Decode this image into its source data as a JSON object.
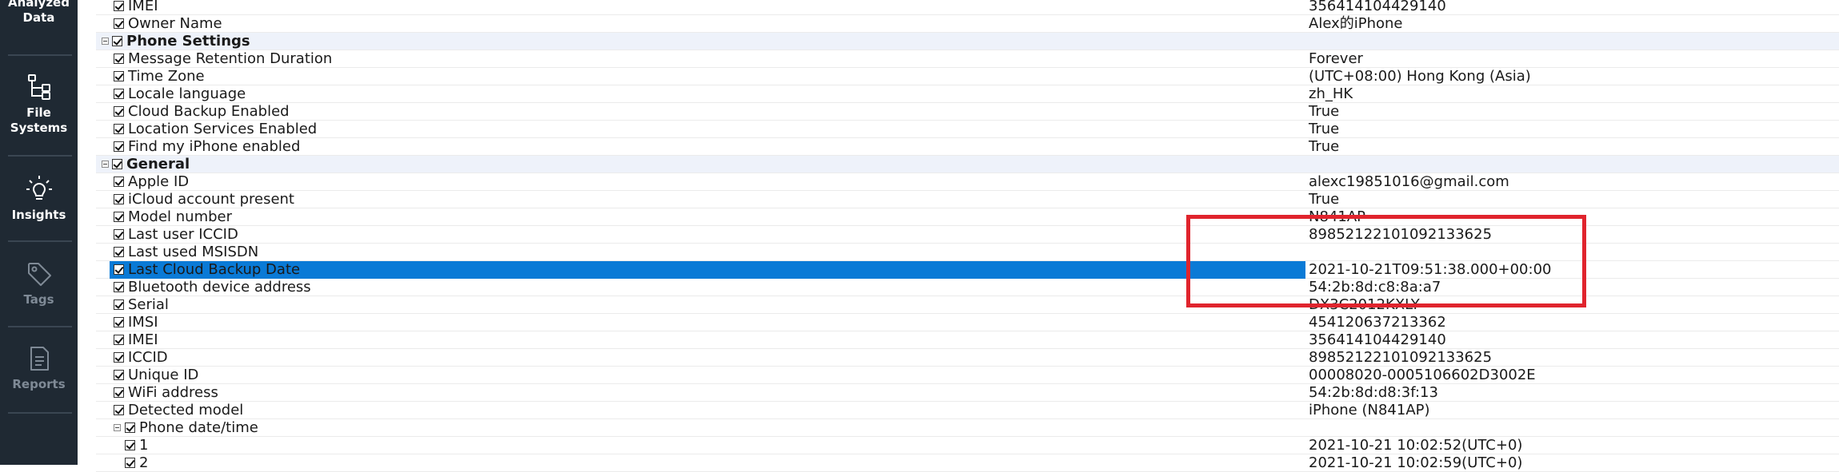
{
  "sidebar": {
    "items": [
      {
        "label": "Analyzed\nData",
        "icon": "analyzed-data-icon",
        "active": true
      },
      {
        "label": "File\nSystems",
        "icon": "file-systems-icon",
        "active": true
      },
      {
        "label": "Insights",
        "icon": "lightbulb-icon",
        "active": true
      },
      {
        "label": "Tags",
        "icon": "tag-icon",
        "active": false
      },
      {
        "label": "Reports",
        "icon": "report-icon",
        "active": false
      }
    ]
  },
  "tree": {
    "rows": [
      {
        "label": "IMEI",
        "value": "356414104429140",
        "level": 1,
        "group": false
      },
      {
        "label": "Owner Name",
        "value": "Alex的iPhone",
        "level": 1,
        "group": false
      },
      {
        "label": "Phone Settings",
        "value": "",
        "level": 0,
        "group": true
      },
      {
        "label": "Message Retention Duration",
        "value": "Forever",
        "level": 1,
        "group": false
      },
      {
        "label": "Time Zone",
        "value": "(UTC+08:00) Hong Kong (Asia)",
        "level": 1,
        "group": false
      },
      {
        "label": "Locale language",
        "value": "zh_HK",
        "level": 1,
        "group": false
      },
      {
        "label": "Cloud Backup Enabled",
        "value": "True",
        "level": 1,
        "group": false
      },
      {
        "label": "Location Services Enabled",
        "value": "True",
        "level": 1,
        "group": false
      },
      {
        "label": "Find my iPhone enabled",
        "value": "True",
        "level": 1,
        "group": false
      },
      {
        "label": "General",
        "value": "",
        "level": 0,
        "group": true
      },
      {
        "label": "Apple ID",
        "value": "alexc19851016@gmail.com",
        "level": 1,
        "group": false
      },
      {
        "label": "iCloud account present",
        "value": "True",
        "level": 1,
        "group": false
      },
      {
        "label": "Model number",
        "value": "N841AP",
        "level": 1,
        "group": false
      },
      {
        "label": "Last user ICCID",
        "value": "89852122101092133625",
        "level": 1,
        "group": false
      },
      {
        "label": "Last used MSISDN",
        "value": "",
        "level": 1,
        "group": false
      },
      {
        "label": "Last Cloud Backup Date",
        "value": "2021-10-21T09:51:38.000+00:00",
        "level": 1,
        "group": false,
        "selected": true
      },
      {
        "label": "Bluetooth device address",
        "value": "54:2b:8d:c8:8a:a7",
        "level": 1,
        "group": false
      },
      {
        "label": "Serial",
        "value": "DX3C2012KXLY",
        "level": 1,
        "group": false
      },
      {
        "label": "IMSI",
        "value": "454120637213362",
        "level": 1,
        "group": false
      },
      {
        "label": "IMEI",
        "value": "356414104429140",
        "level": 1,
        "group": false
      },
      {
        "label": "ICCID",
        "value": "89852122101092133625",
        "level": 1,
        "group": false
      },
      {
        "label": "Unique ID",
        "value": "00008020-0005106602D3002E",
        "level": 1,
        "group": false
      },
      {
        "label": "WiFi address",
        "value": "54:2b:8d:d8:3f:13",
        "level": 1,
        "group": false
      },
      {
        "label": "Detected model",
        "value": "iPhone (N841AP)",
        "level": 1,
        "group": false
      },
      {
        "label": "Phone date/time",
        "value": "",
        "level": 1,
        "group": false,
        "expandable": true
      },
      {
        "label": "1",
        "value": "2021-10-21 10:02:52(UTC+0)",
        "level": 2,
        "group": false
      },
      {
        "label": "2",
        "value": "2021-10-21 10:02:59(UTC+0)",
        "level": 2,
        "group": false
      }
    ]
  },
  "colors": {
    "sidebar_bg": "#1f2933",
    "selection": "#0a7ad6",
    "highlight_box": "#e0242d",
    "group_row_bg": "#eef2fa"
  }
}
